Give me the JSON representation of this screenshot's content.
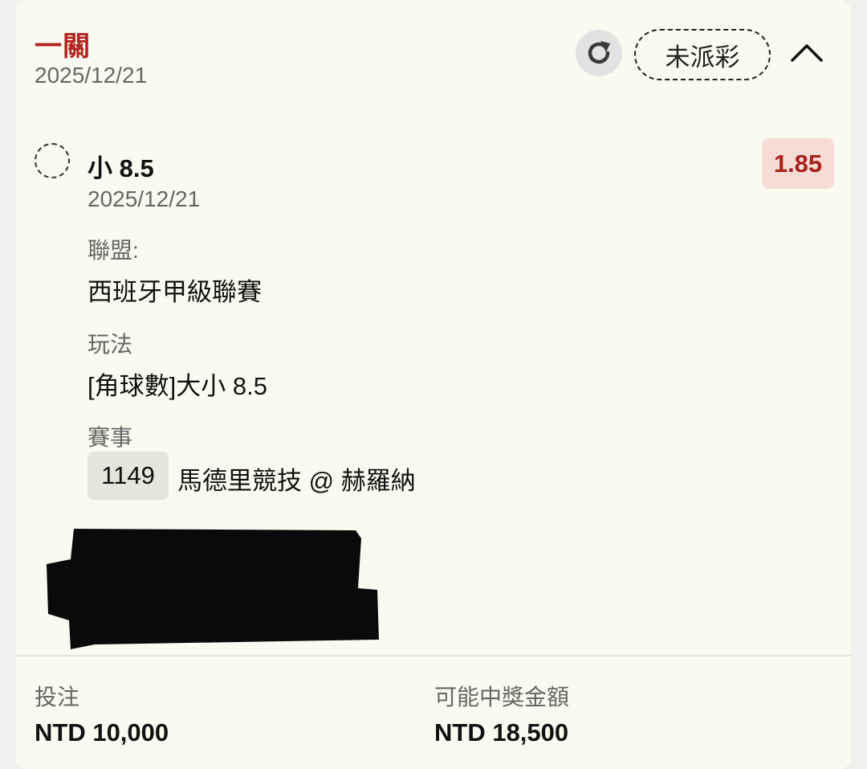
{
  "header": {
    "bet_type": "一關",
    "date": "2025/12/21",
    "status": "未派彩"
  },
  "selection": {
    "name": "小 8.5",
    "date": "2025/12/21",
    "odds": "1.85",
    "league_label": "聯盟:",
    "league_value": "西班牙甲級聯賽",
    "market_label": "玩法",
    "market_value": "[角球數]大小 8.5",
    "event_label": "賽事",
    "match_id": "1149",
    "match_name": "馬德里競技 @ 赫羅納"
  },
  "footer": {
    "stake_label": "投注",
    "stake_value": "NTD 10,000",
    "payout_label": "可能中獎金額",
    "payout_value": "NTD 18,500"
  },
  "icons": {
    "refresh": "refresh-icon",
    "collapse": "chevron-up-icon",
    "selection_status": "pending-circle-icon"
  },
  "colors": {
    "accent_red": "#b3241f",
    "odds_bg": "#f7dcd6",
    "card_bg": "#fbfaf1"
  }
}
